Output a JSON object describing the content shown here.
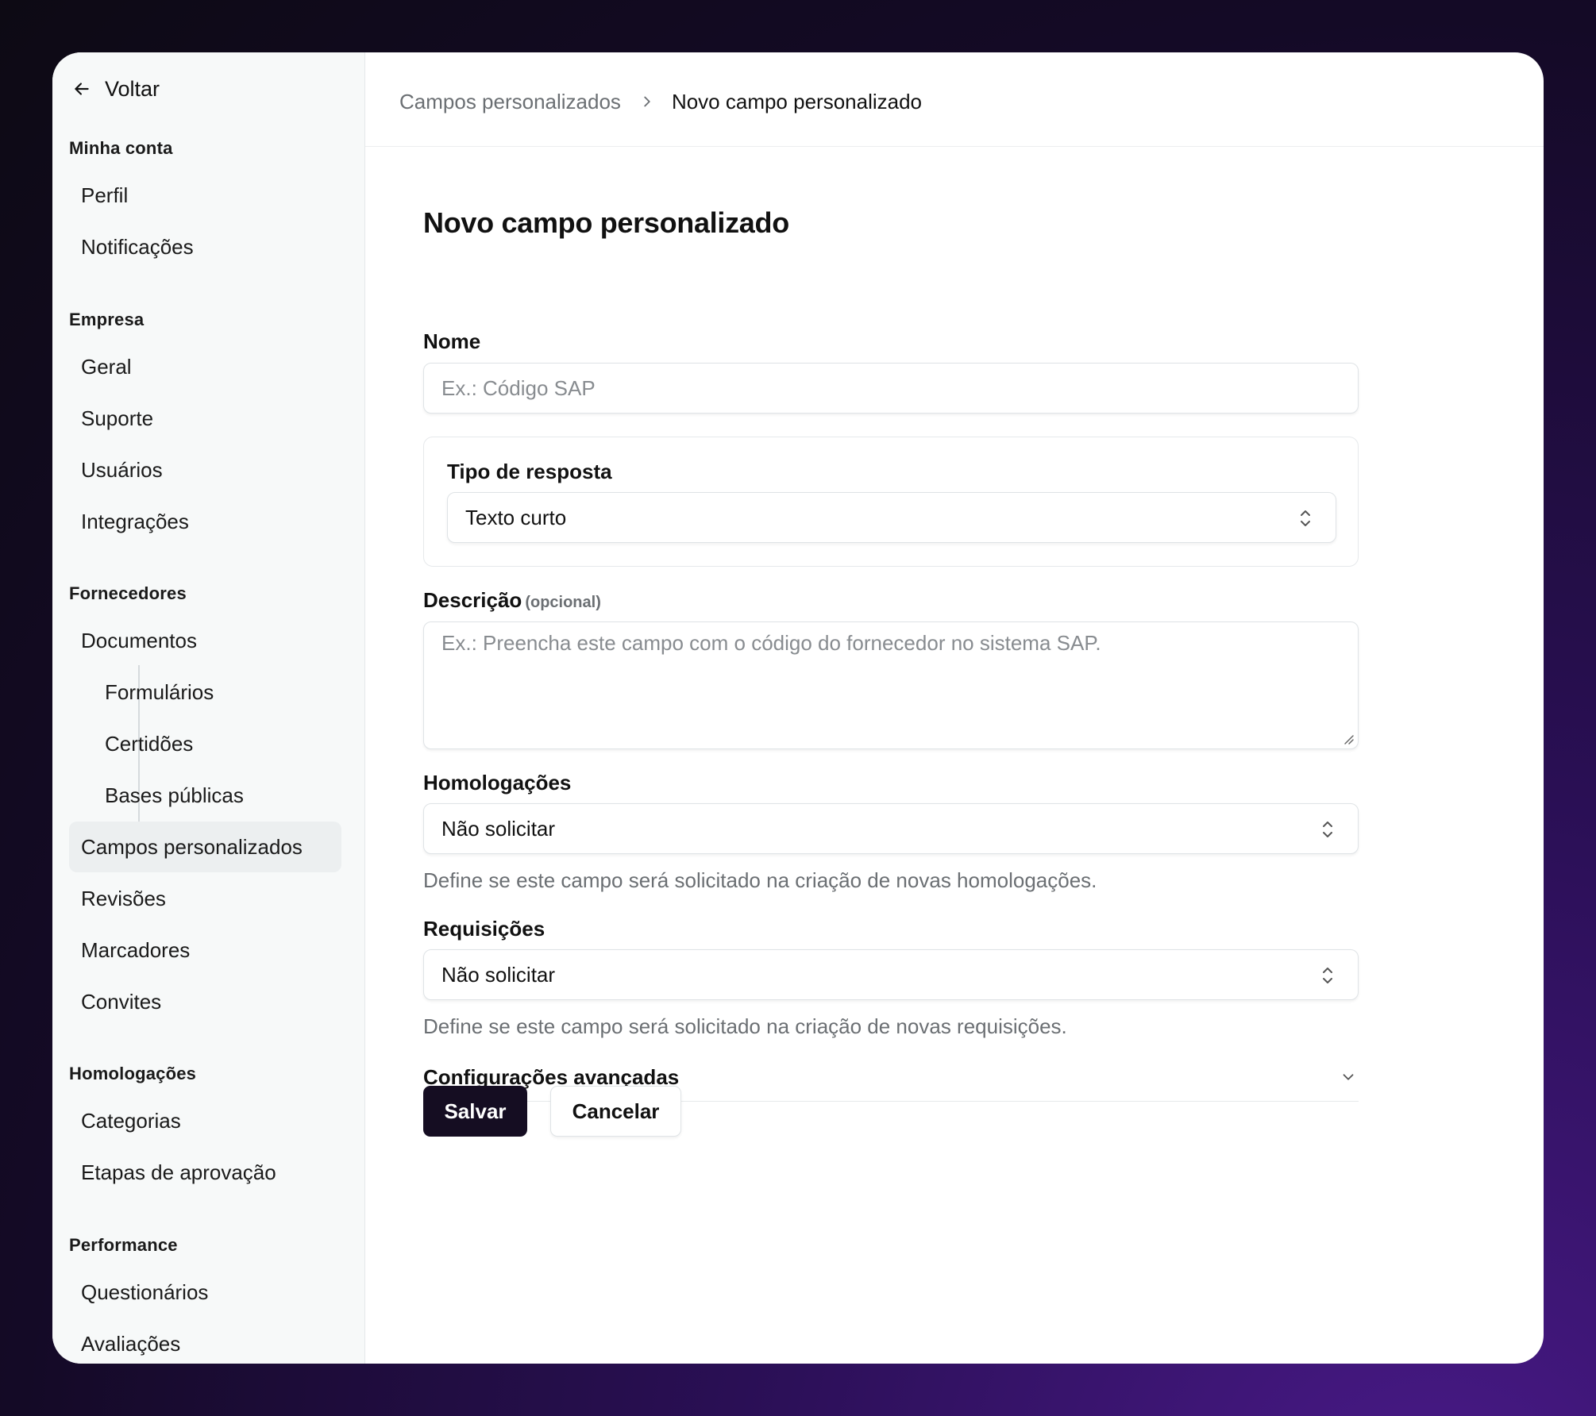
{
  "sidebar": {
    "back_label": "Voltar",
    "sections": [
      {
        "title": "Minha conta",
        "items": [
          "Perfil",
          "Notificações"
        ]
      },
      {
        "title": "Empresa",
        "items": [
          "Geral",
          "Suporte",
          "Usuários",
          "Integrações"
        ]
      },
      {
        "title": "Fornecedores",
        "items": [
          "Documentos",
          "Formulários",
          "Certidões",
          "Bases públicas",
          "Campos personalizados",
          "Revisões",
          "Marcadores",
          "Convites"
        ]
      },
      {
        "title": "Homologações",
        "items": [
          "Categorias",
          "Etapas de aprovação"
        ]
      },
      {
        "title": "Performance",
        "items": [
          "Questionários",
          "Avaliações"
        ]
      }
    ],
    "active_item": "Campos personalizados"
  },
  "breadcrumb": {
    "parent": "Campos personalizados",
    "current": "Novo campo personalizado"
  },
  "form": {
    "title": "Novo campo personalizado",
    "name": {
      "label": "Nome",
      "placeholder": "Ex.: Código SAP",
      "value": ""
    },
    "response_type": {
      "label": "Tipo de resposta",
      "selected": "Texto curto"
    },
    "description": {
      "label": "Descrição",
      "optional_tag": "(opcional)",
      "placeholder": "Ex.: Preencha este campo com o código do fornecedor no sistema SAP."
    },
    "homologacoes": {
      "label": "Homologações",
      "selected": "Não solicitar",
      "help": "Define se este campo será solicitado na criação de novas homologações."
    },
    "requisicoes": {
      "label": "Requisições",
      "selected": "Não solicitar",
      "help": "Define se este campo será solicitado na criação de novas requisições."
    },
    "advanced_label": "Configurações avançadas",
    "save_label": "Salvar",
    "cancel_label": "Cancelar"
  },
  "colors": {
    "primary_button": "#150d22",
    "sidebar_bg": "#f7f9f9",
    "active_item_bg": "#eceff0"
  }
}
